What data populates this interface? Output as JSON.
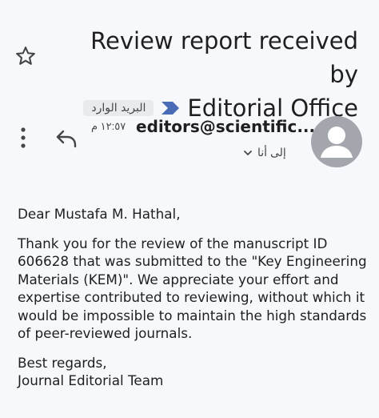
{
  "header": {
    "subject_line1": "Review report received by",
    "subject_line2": "Editorial Office",
    "label": "البريد الوارد",
    "importance_color": "#4a6bb5"
  },
  "sender": {
    "name": "editors@scientific....",
    "time": "١٢:٥٧ م",
    "recipient": "إلى أنا"
  },
  "icons": {
    "star": "star-icon",
    "more": "more-vert-icon",
    "reply": "reply-icon",
    "chevron": "chevron-down-icon",
    "avatar": "person-icon"
  },
  "message": {
    "greeting": "Dear Mustafa M. Hathal,",
    "paragraph": "Thank you for the review of the manuscript ID 606628 that was submitted to the \"Key Engineering Materials (KEM)\". We appreciate your effort and expertise contributed to reviewing, without which it would be impossible to maintain the high standards of peer-reviewed journals.",
    "closing": "Best regards,",
    "signature": "Journal Editorial Team"
  }
}
